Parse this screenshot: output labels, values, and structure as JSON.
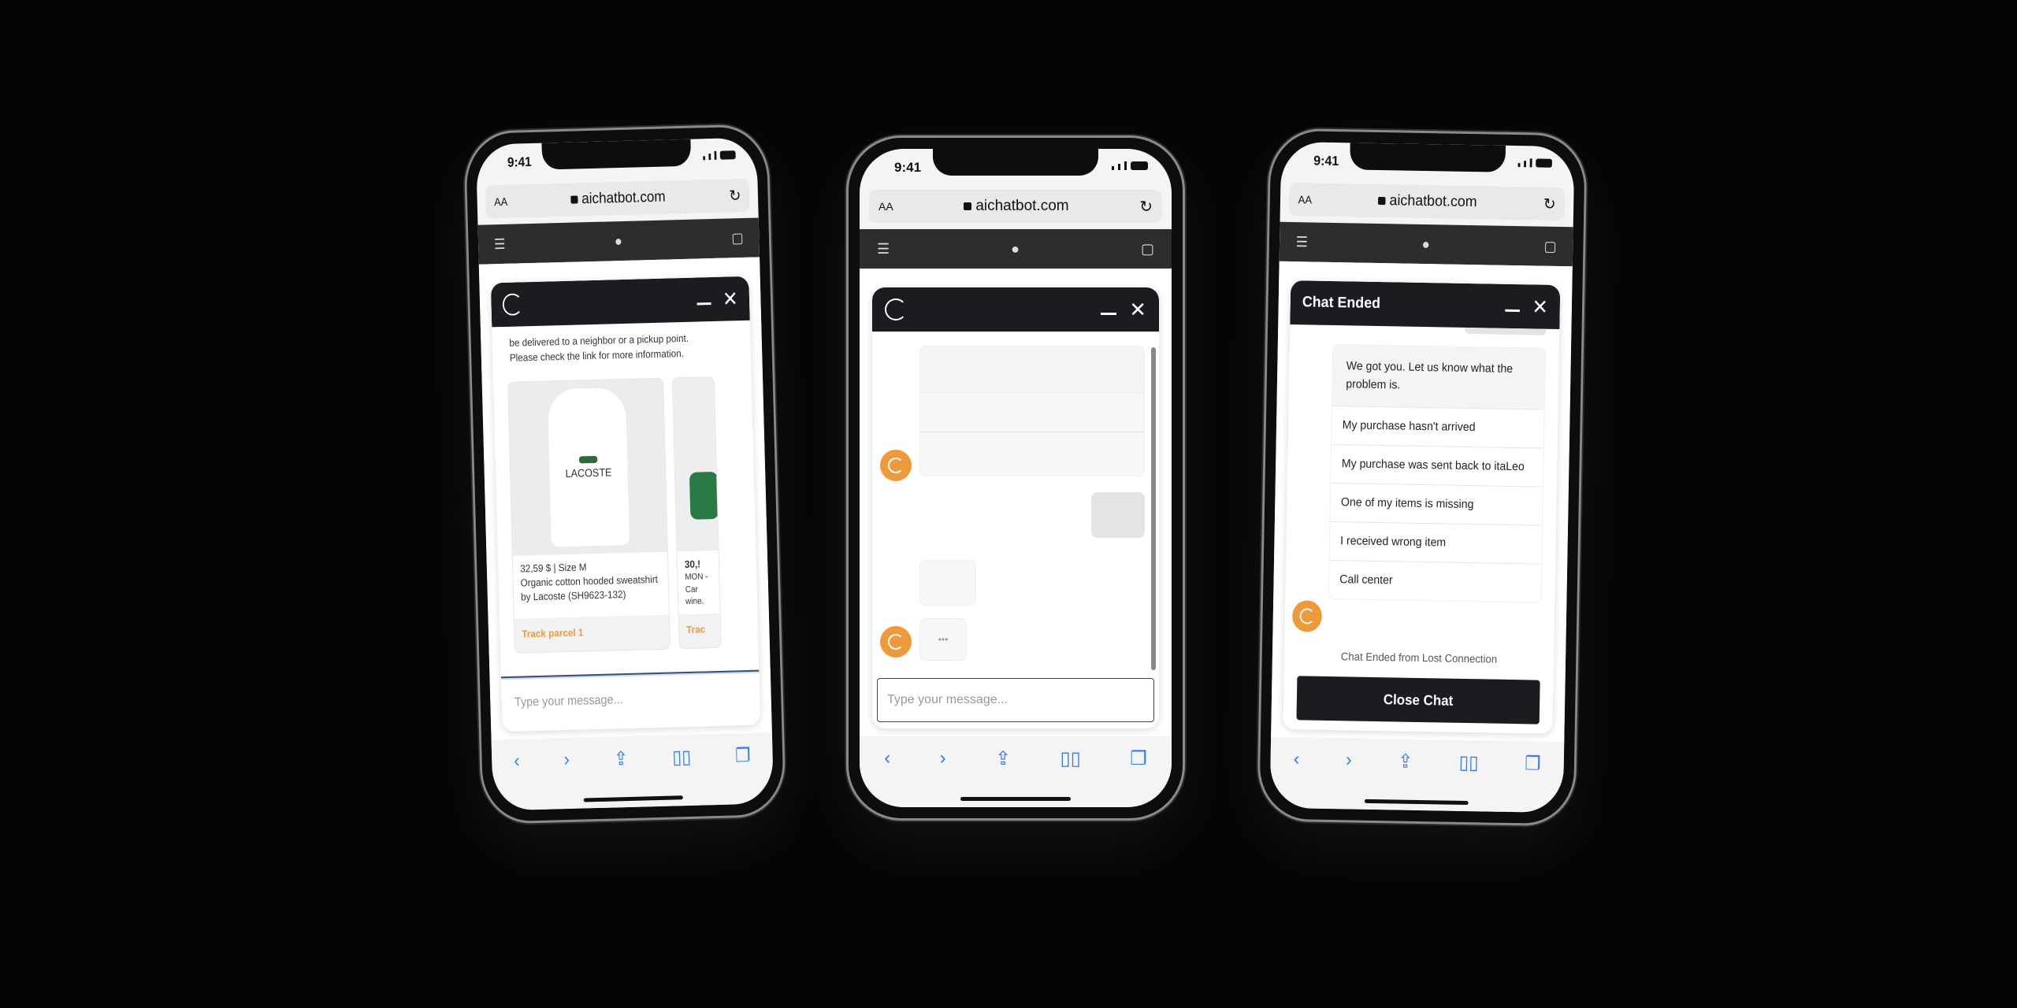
{
  "browser": {
    "time": "9:41",
    "text_size": "AA",
    "url": "aichatbot.com"
  },
  "colors": {
    "accent": "#ef9a3a",
    "header": "#1b1b20",
    "safari_blue": "#3478f6"
  },
  "icons": [
    "chatbot-logo-icon",
    "minimize-icon",
    "close-icon",
    "apple-logo-icon",
    "bag-icon",
    "menu-icon",
    "reload-icon",
    "back-icon",
    "forward-icon",
    "share-icon",
    "bookmarks-icon",
    "tabs-icon"
  ],
  "phone1": {
    "intro_line1": "be delivered to a neighbor or a pickup point.",
    "intro_line2": "Please check the link for more information.",
    "products": [
      {
        "image_label": "LACOSTE",
        "price": "32,59 $  | Size M",
        "description": "Organic cotton hooded sweatshirt by Lacoste (SH9623-132)",
        "link": "Track parcel 1"
      },
      {
        "price": "30,!",
        "description": "MON - Car wine.",
        "link": "Trac"
      }
    ],
    "input_placeholder": "Type your message..."
  },
  "phone2": {
    "typing": "•••",
    "input_placeholder": "Type your message..."
  },
  "phone3": {
    "title": "Chat Ended",
    "question": "We got you. Let us know what the problem is.",
    "options": [
      "My purchase hasn't arrived",
      "My purchase was sent back to itaLeo",
      "One of my items is missing",
      "I received wrong item",
      "Call center"
    ],
    "status": "Chat Ended from Lost Connection",
    "close_button": "Close Chat"
  }
}
